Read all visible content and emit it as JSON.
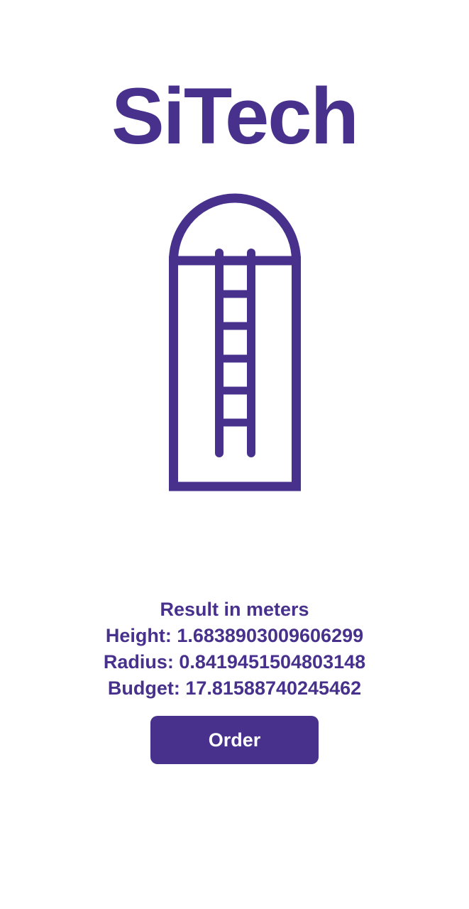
{
  "app": {
    "title": "SiTech"
  },
  "illustration": {
    "icon": "silo-icon",
    "color": "#47318c"
  },
  "result": {
    "heading": "Result in meters",
    "height_line": "Height: 1.6838903009606299",
    "radius_line": "Radius: 0.8419451504803148",
    "budget_line": "Budget: 17.815887402454 62"
  },
  "actions": {
    "order_label": "Order"
  },
  "theme": {
    "accent": "#47318c",
    "background": "#ffffff",
    "button_text": "#ffffff"
  }
}
